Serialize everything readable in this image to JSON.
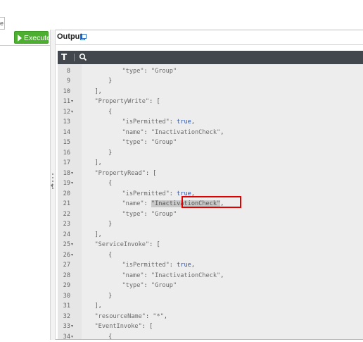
{
  "left_tab": {
    "label": "e"
  },
  "toolbar": {
    "execute_label": "Execute"
  },
  "output": {
    "title": "Output"
  },
  "editor": {
    "font_icon": "T",
    "lines": [
      {
        "n": "8",
        "fold": "",
        "indent": 5,
        "parts": [
          [
            "k",
            "\"type\""
          ],
          [
            "p",
            ": "
          ],
          [
            "s",
            "\"Group\""
          ]
        ]
      },
      {
        "n": "9",
        "fold": "",
        "indent": 4,
        "parts": [
          [
            "p",
            "}"
          ]
        ]
      },
      {
        "n": "10",
        "fold": "",
        "indent": 3,
        "parts": [
          [
            "p",
            "],"
          ]
        ]
      },
      {
        "n": "11",
        "fold": "▾",
        "indent": 3,
        "parts": [
          [
            "k",
            "\"PropertyWrite\""
          ],
          [
            "p",
            ": ["
          ]
        ]
      },
      {
        "n": "12",
        "fold": "▾",
        "indent": 4,
        "parts": [
          [
            "p",
            "{"
          ]
        ]
      },
      {
        "n": "13",
        "fold": "",
        "indent": 5,
        "parts": [
          [
            "k",
            "\"isPermitted\""
          ],
          [
            "p",
            ": "
          ],
          [
            "b",
            "true"
          ],
          [
            "p",
            ","
          ]
        ]
      },
      {
        "n": "14",
        "fold": "",
        "indent": 5,
        "parts": [
          [
            "k",
            "\"name\""
          ],
          [
            "p",
            ": "
          ],
          [
            "s",
            "\"InactivationCheck\""
          ],
          [
            "p",
            ","
          ]
        ]
      },
      {
        "n": "15",
        "fold": "",
        "indent": 5,
        "parts": [
          [
            "k",
            "\"type\""
          ],
          [
            "p",
            ": "
          ],
          [
            "s",
            "\"Group\""
          ]
        ]
      },
      {
        "n": "16",
        "fold": "",
        "indent": 4,
        "parts": [
          [
            "p",
            "}"
          ]
        ]
      },
      {
        "n": "17",
        "fold": "",
        "indent": 3,
        "parts": [
          [
            "p",
            "],"
          ]
        ]
      },
      {
        "n": "18",
        "fold": "▾",
        "indent": 3,
        "parts": [
          [
            "k",
            "\"PropertyRead\""
          ],
          [
            "p",
            ": ["
          ]
        ]
      },
      {
        "n": "19",
        "fold": "▾",
        "indent": 4,
        "parts": [
          [
            "p",
            "{"
          ]
        ]
      },
      {
        "n": "20",
        "fold": "",
        "indent": 5,
        "parts": [
          [
            "k",
            "\"isPermitted\""
          ],
          [
            "p",
            ": "
          ],
          [
            "b",
            "true"
          ],
          [
            "p",
            ","
          ]
        ]
      },
      {
        "n": "21",
        "fold": "",
        "indent": 5,
        "parts": [
          [
            "k",
            "\"name\""
          ],
          [
            "p",
            ": "
          ],
          [
            "sel",
            "\"InactivationCheck\""
          ],
          [
            "p",
            ","
          ]
        ]
      },
      {
        "n": "22",
        "fold": "",
        "indent": 5,
        "parts": [
          [
            "k",
            "\"type\""
          ],
          [
            "p",
            ": "
          ],
          [
            "s",
            "\"Group\""
          ]
        ]
      },
      {
        "n": "23",
        "fold": "",
        "indent": 4,
        "parts": [
          [
            "p",
            "}"
          ]
        ]
      },
      {
        "n": "24",
        "fold": "",
        "indent": 3,
        "parts": [
          [
            "p",
            "],"
          ]
        ]
      },
      {
        "n": "25",
        "fold": "▾",
        "indent": 3,
        "parts": [
          [
            "k",
            "\"ServiceInvoke\""
          ],
          [
            "p",
            ": ["
          ]
        ]
      },
      {
        "n": "26",
        "fold": "▾",
        "indent": 4,
        "parts": [
          [
            "p",
            "{"
          ]
        ]
      },
      {
        "n": "27",
        "fold": "",
        "indent": 5,
        "parts": [
          [
            "k",
            "\"isPermitted\""
          ],
          [
            "p",
            ": "
          ],
          [
            "b",
            "true"
          ],
          [
            "p",
            ","
          ]
        ]
      },
      {
        "n": "28",
        "fold": "",
        "indent": 5,
        "parts": [
          [
            "k",
            "\"name\""
          ],
          [
            "p",
            ": "
          ],
          [
            "s",
            "\"InactivationCheck\""
          ],
          [
            "p",
            ","
          ]
        ]
      },
      {
        "n": "29",
        "fold": "",
        "indent": 5,
        "parts": [
          [
            "k",
            "\"type\""
          ],
          [
            "p",
            ": "
          ],
          [
            "s",
            "\"Group\""
          ]
        ]
      },
      {
        "n": "30",
        "fold": "",
        "indent": 4,
        "parts": [
          [
            "p",
            "}"
          ]
        ]
      },
      {
        "n": "31",
        "fold": "",
        "indent": 3,
        "parts": [
          [
            "p",
            "],"
          ]
        ]
      },
      {
        "n": "32",
        "fold": "",
        "indent": 3,
        "parts": [
          [
            "k",
            "\"resourceName\""
          ],
          [
            "p",
            ": "
          ],
          [
            "s",
            "\"*\""
          ],
          [
            "p",
            ","
          ]
        ]
      },
      {
        "n": "33",
        "fold": "▾",
        "indent": 3,
        "parts": [
          [
            "k",
            "\"EventInvoke\""
          ],
          [
            "p",
            ": ["
          ]
        ]
      },
      {
        "n": "34",
        "fold": "▾",
        "indent": 4,
        "parts": [
          [
            "p",
            "{"
          ]
        ]
      }
    ]
  },
  "colors": {
    "execute_bg": "#4caf2f",
    "toolbar_bg": "#41474d",
    "highlight": "#e00000"
  }
}
